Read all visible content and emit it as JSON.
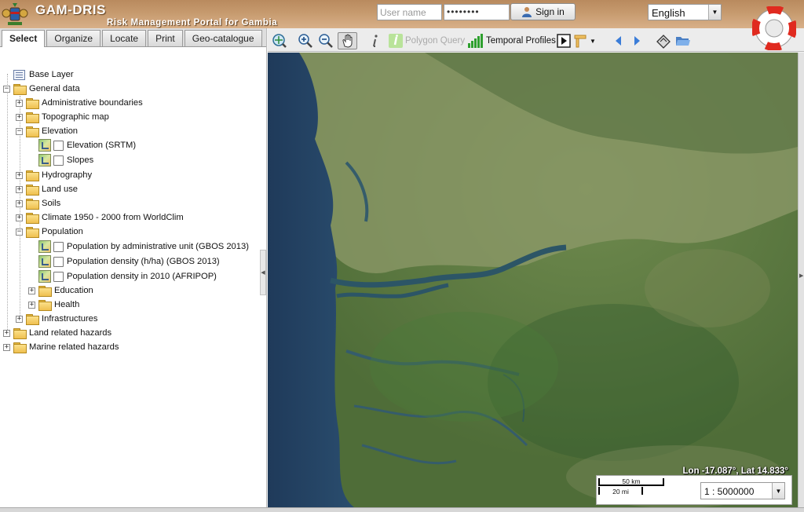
{
  "header": {
    "title": "GAM-DRIS",
    "subtitle": "Risk Management Portal for Gambia",
    "username_placeholder": "User name",
    "password_value": "••••••••",
    "signin_label": "Sign in",
    "language": "English"
  },
  "tabs": [
    "Select",
    "Organize",
    "Locate",
    "Print",
    "Geo-catalogue"
  ],
  "active_tab": "Select",
  "tree": {
    "base_layer": "Base Layer",
    "general_data": "General data",
    "admin": "Administrative boundaries",
    "topo": "Topographic map",
    "elevation": "Elevation",
    "elev_srtm": "Elevation (SRTM)",
    "slopes": "Slopes",
    "hydro": "Hydrography",
    "landuse": "Land use",
    "soils": "Soils",
    "climate": "Climate 1950 - 2000 from WorldClim",
    "population": "Population",
    "pop_admin": "Population by administrative unit (GBOS 2013)",
    "pop_density": "Population density (h/ha) (GBOS 2013)",
    "pop_afripop": "Population density in 2010 (AFRIPOP)",
    "education": "Education",
    "health": "Health",
    "infra": "Infrastructures",
    "land_hazards": "Land related hazards",
    "marine_hazards": "Marine related hazards"
  },
  "toolbar": {
    "polygon_query": "Polygon Query",
    "temporal_profiles": "Temporal Profiles"
  },
  "map": {
    "coords": "Lon -17.087°, Lat 14.833°",
    "scale_km": "50 km",
    "scale_mi": "20 mi",
    "scale_value": "1 : 5000000"
  }
}
